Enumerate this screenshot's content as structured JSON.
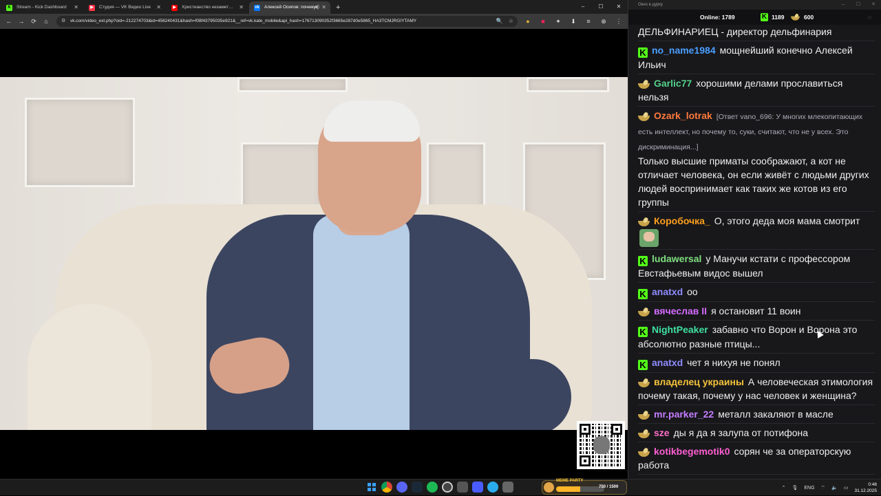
{
  "browser": {
    "tabs": [
      {
        "title": "Stream - Kick Dashboard",
        "favicon": "kick-icon",
        "color": "#53fc18",
        "active": false
      },
      {
        "title": "Студия — VK Видео Live",
        "favicon": "vk-video-icon",
        "color": "#ff3347",
        "active": false
      },
      {
        "title": "Христианство незаметно уход",
        "favicon": "youtube-icon",
        "color": "#ff0000",
        "active": false
      },
      {
        "title": "Алексей Осипов: почему",
        "favicon": "vk-icon",
        "color": "#0077ff",
        "active": true
      }
    ],
    "new_tab": "+",
    "window_controls": [
      "–",
      "☐",
      "✕"
    ],
    "url": "vk.com/video_ext.php?oid=-212274703&id=456240431&hash=f08f43795035e921&__ref=vk.kate_mobile&api_hash=176713090352f3665e287d0e5865_HA3TCMJRGIYTAMY",
    "nav": {
      "back": "←",
      "forward": "→",
      "reload": "⟳",
      "home": "⌂"
    },
    "url_icons": [
      "🔍",
      "☆"
    ],
    "toolbar_icons": [
      "⬇",
      "≡",
      "⊕",
      "⋮"
    ]
  },
  "chat": {
    "window_title": "Окно в дурку",
    "online_label": "Online: 1789",
    "kick_count": "1189",
    "gold_count": "600",
    "messages": [
      {
        "badge": "none",
        "user": "",
        "color": "#efeff1",
        "reply": "",
        "text": "ДЕЛЬФИНАРИЕЦ - директор дельфинария"
      },
      {
        "badge": "kick",
        "user": "no_name1984",
        "color": "#4b9fff",
        "reply": "",
        "text": "мощнейший конечно Алексей Ильич"
      },
      {
        "badge": "gold",
        "user": "Garlic77",
        "color": "#53d18a",
        "reply": "",
        "text": "хорошими делами прославиться нельзя"
      },
      {
        "badge": "gold",
        "user": "Ozark_lotrak",
        "color": "#ff7a3d",
        "reply": "[Ответ vano_696: У многих млекопитающих есть интеллект, но почему то, суки, считают, что не у всех. Это дискриминация...]",
        "text": "Только высшие приматы соображают, а кот не отличает человека, он если живёт с людьми других людей воспринимает как таких же котов из его группы"
      },
      {
        "badge": "gold",
        "user": "Коробочка_",
        "color": "#ff9f1c",
        "reply": "",
        "text": "О, этого деда моя мама смотрит",
        "emote": "persona-emote"
      },
      {
        "badge": "kick",
        "user": "ludawersal",
        "color": "#7fe07f",
        "reply": "",
        "text": "у Манучи кстати с профессором Евстафьевым видос вышел"
      },
      {
        "badge": "kick",
        "user": "anatxd",
        "color": "#8f8cff",
        "reply": "",
        "text": "оо"
      },
      {
        "badge": "gold",
        "user": "вячеслав II",
        "color": "#d46bff",
        "reply": "",
        "text": "я остановит 11 воин"
      },
      {
        "badge": "kick",
        "user": "NightPeaker",
        "color": "#3fe0a0",
        "reply": "",
        "text": "забавно что Ворон и Ворона это абсолютно разные птицы..."
      },
      {
        "badge": "kick",
        "user": "anatxd",
        "color": "#8f8cff",
        "reply": "",
        "text": "чет я нихуя не понял"
      },
      {
        "badge": "gold",
        "user": "владелец украины",
        "color": "#f5c33b",
        "reply": "",
        "text": "А человеческая этимология почему такая, почему у нас человек и женщина?"
      },
      {
        "badge": "gold",
        "user": "mr.parker_22",
        "color": "#c47dff",
        "reply": "",
        "text": "металл закаляют в масле"
      },
      {
        "badge": "gold",
        "user": "sze",
        "color": "#ff6ec7",
        "reply": "",
        "text": "ды я да я залупа от потифона"
      },
      {
        "badge": "gold",
        "user": "kotikbegemotik0",
        "color": "#ff5fd2",
        "reply": "",
        "text": "сорян че за операторскую работа"
      }
    ]
  },
  "taskbar": {
    "meme_party_label": "MEME PARTY",
    "meme_party_count": "750 / 1500",
    "meme_party_progress": 0.5,
    "lang": "ENG",
    "time": "0:48",
    "date": "31.12.2025"
  }
}
